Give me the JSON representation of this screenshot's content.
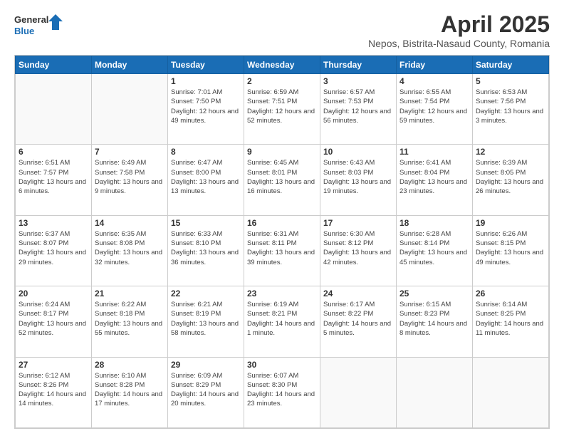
{
  "logo": {
    "text_general": "General",
    "text_blue": "Blue"
  },
  "title": "April 2025",
  "subtitle": "Nepos, Bistrita-Nasaud County, Romania",
  "days_of_week": [
    "Sunday",
    "Monday",
    "Tuesday",
    "Wednesday",
    "Thursday",
    "Friday",
    "Saturday"
  ],
  "weeks": [
    [
      {
        "day": "",
        "info": ""
      },
      {
        "day": "",
        "info": ""
      },
      {
        "day": "1",
        "info": "Sunrise: 7:01 AM\nSunset: 7:50 PM\nDaylight: 12 hours and 49 minutes."
      },
      {
        "day": "2",
        "info": "Sunrise: 6:59 AM\nSunset: 7:51 PM\nDaylight: 12 hours and 52 minutes."
      },
      {
        "day": "3",
        "info": "Sunrise: 6:57 AM\nSunset: 7:53 PM\nDaylight: 12 hours and 56 minutes."
      },
      {
        "day": "4",
        "info": "Sunrise: 6:55 AM\nSunset: 7:54 PM\nDaylight: 12 hours and 59 minutes."
      },
      {
        "day": "5",
        "info": "Sunrise: 6:53 AM\nSunset: 7:56 PM\nDaylight: 13 hours and 3 minutes."
      }
    ],
    [
      {
        "day": "6",
        "info": "Sunrise: 6:51 AM\nSunset: 7:57 PM\nDaylight: 13 hours and 6 minutes."
      },
      {
        "day": "7",
        "info": "Sunrise: 6:49 AM\nSunset: 7:58 PM\nDaylight: 13 hours and 9 minutes."
      },
      {
        "day": "8",
        "info": "Sunrise: 6:47 AM\nSunset: 8:00 PM\nDaylight: 13 hours and 13 minutes."
      },
      {
        "day": "9",
        "info": "Sunrise: 6:45 AM\nSunset: 8:01 PM\nDaylight: 13 hours and 16 minutes."
      },
      {
        "day": "10",
        "info": "Sunrise: 6:43 AM\nSunset: 8:03 PM\nDaylight: 13 hours and 19 minutes."
      },
      {
        "day": "11",
        "info": "Sunrise: 6:41 AM\nSunset: 8:04 PM\nDaylight: 13 hours and 23 minutes."
      },
      {
        "day": "12",
        "info": "Sunrise: 6:39 AM\nSunset: 8:05 PM\nDaylight: 13 hours and 26 minutes."
      }
    ],
    [
      {
        "day": "13",
        "info": "Sunrise: 6:37 AM\nSunset: 8:07 PM\nDaylight: 13 hours and 29 minutes."
      },
      {
        "day": "14",
        "info": "Sunrise: 6:35 AM\nSunset: 8:08 PM\nDaylight: 13 hours and 32 minutes."
      },
      {
        "day": "15",
        "info": "Sunrise: 6:33 AM\nSunset: 8:10 PM\nDaylight: 13 hours and 36 minutes."
      },
      {
        "day": "16",
        "info": "Sunrise: 6:31 AM\nSunset: 8:11 PM\nDaylight: 13 hours and 39 minutes."
      },
      {
        "day": "17",
        "info": "Sunrise: 6:30 AM\nSunset: 8:12 PM\nDaylight: 13 hours and 42 minutes."
      },
      {
        "day": "18",
        "info": "Sunrise: 6:28 AM\nSunset: 8:14 PM\nDaylight: 13 hours and 45 minutes."
      },
      {
        "day": "19",
        "info": "Sunrise: 6:26 AM\nSunset: 8:15 PM\nDaylight: 13 hours and 49 minutes."
      }
    ],
    [
      {
        "day": "20",
        "info": "Sunrise: 6:24 AM\nSunset: 8:17 PM\nDaylight: 13 hours and 52 minutes."
      },
      {
        "day": "21",
        "info": "Sunrise: 6:22 AM\nSunset: 8:18 PM\nDaylight: 13 hours and 55 minutes."
      },
      {
        "day": "22",
        "info": "Sunrise: 6:21 AM\nSunset: 8:19 PM\nDaylight: 13 hours and 58 minutes."
      },
      {
        "day": "23",
        "info": "Sunrise: 6:19 AM\nSunset: 8:21 PM\nDaylight: 14 hours and 1 minute."
      },
      {
        "day": "24",
        "info": "Sunrise: 6:17 AM\nSunset: 8:22 PM\nDaylight: 14 hours and 5 minutes."
      },
      {
        "day": "25",
        "info": "Sunrise: 6:15 AM\nSunset: 8:23 PM\nDaylight: 14 hours and 8 minutes."
      },
      {
        "day": "26",
        "info": "Sunrise: 6:14 AM\nSunset: 8:25 PM\nDaylight: 14 hours and 11 minutes."
      }
    ],
    [
      {
        "day": "27",
        "info": "Sunrise: 6:12 AM\nSunset: 8:26 PM\nDaylight: 14 hours and 14 minutes."
      },
      {
        "day": "28",
        "info": "Sunrise: 6:10 AM\nSunset: 8:28 PM\nDaylight: 14 hours and 17 minutes."
      },
      {
        "day": "29",
        "info": "Sunrise: 6:09 AM\nSunset: 8:29 PM\nDaylight: 14 hours and 20 minutes."
      },
      {
        "day": "30",
        "info": "Sunrise: 6:07 AM\nSunset: 8:30 PM\nDaylight: 14 hours and 23 minutes."
      },
      {
        "day": "",
        "info": ""
      },
      {
        "day": "",
        "info": ""
      },
      {
        "day": "",
        "info": ""
      }
    ]
  ]
}
